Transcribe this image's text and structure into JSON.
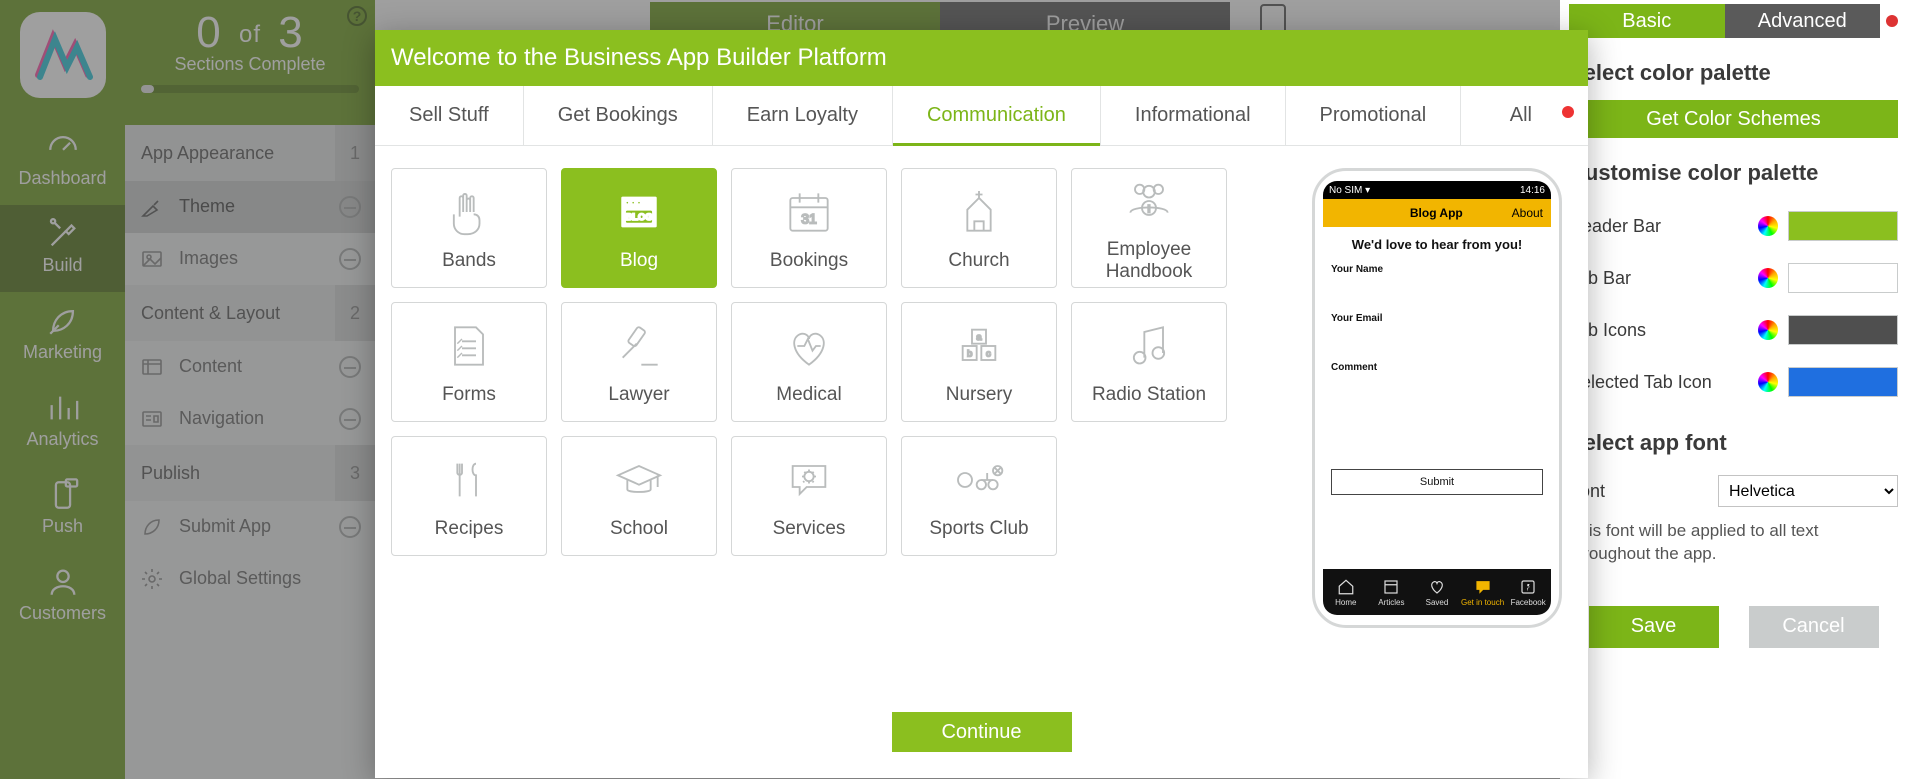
{
  "rail": {
    "items": [
      {
        "label": "Dashboard"
      },
      {
        "label": "Build"
      },
      {
        "label": "Marketing"
      },
      {
        "label": "Analytics"
      },
      {
        "label": "Push"
      },
      {
        "label": "Customers"
      }
    ]
  },
  "progress": {
    "done": "0",
    "of_label": "of",
    "total": "3",
    "subtitle": "Sections Complete"
  },
  "sections": {
    "app_appearance": {
      "title": "App Appearance",
      "badge": "1",
      "items": [
        {
          "label": "Theme"
        },
        {
          "label": "Images"
        }
      ]
    },
    "content_layout": {
      "title": "Content & Layout",
      "badge": "2",
      "items": [
        {
          "label": "Content"
        },
        {
          "label": "Navigation"
        }
      ]
    },
    "publish": {
      "title": "Publish",
      "badge": "3",
      "items": [
        {
          "label": "Submit App"
        },
        {
          "label": "Global Settings"
        }
      ]
    }
  },
  "center_tabs": {
    "editor": "Editor",
    "preview": "Preview"
  },
  "right": {
    "mode_basic": "Basic",
    "mode_advanced": "Advanced",
    "select_palette": "Select color palette",
    "get_schemes": "Get Color Schemes",
    "customise": "Customise color palette",
    "rows": {
      "header_bar": {
        "label": "Header Bar",
        "color": "#8bbf1f"
      },
      "tab_bar": {
        "label": "Tab Bar",
        "color": "#ffffff"
      },
      "tab_icons": {
        "label": "Tab Icons",
        "color": "#4f4f4f"
      },
      "selected_tab": {
        "label": "Selected Tab Icon",
        "color": "#1f6fe0"
      }
    },
    "select_font": "Select app font",
    "font_label": "Font",
    "font_value": "Helvetica",
    "font_hint": "This font will be applied to all text throughout the app.",
    "save": "Save",
    "cancel": "Cancel"
  },
  "modal": {
    "title": "Welcome to the Business App Builder Platform",
    "tabs": [
      "Sell Stuff",
      "Get Bookings",
      "Earn Loyalty",
      "Communication",
      "Informational",
      "Promotional",
      "All"
    ],
    "active_tab": "Communication",
    "tiles": [
      {
        "label": "Bands"
      },
      {
        "label": "Blog"
      },
      {
        "label": "Bookings"
      },
      {
        "label": "Church"
      },
      {
        "label": "Employee Handbook"
      },
      {
        "label": "Forms"
      },
      {
        "label": "Lawyer"
      },
      {
        "label": "Medical"
      },
      {
        "label": "Nursery"
      },
      {
        "label": "Radio Station"
      },
      {
        "label": "Recipes"
      },
      {
        "label": "School"
      },
      {
        "label": "Services"
      },
      {
        "label": "Sports Club"
      }
    ],
    "active_tile": "Blog",
    "continue": "Continue",
    "phone": {
      "status_left": "No SIM ▾",
      "status_right": "14:16",
      "appbar_title": "Blog App",
      "appbar_right": "About",
      "heading": "We'd love to hear from you!",
      "name_label": "Your Name",
      "email_label": "Your Email",
      "comment_label": "Comment",
      "submit": "Submit",
      "tabs": [
        "Home",
        "Articles",
        "Saved",
        "Get in touch",
        "Facebook"
      ]
    }
  }
}
